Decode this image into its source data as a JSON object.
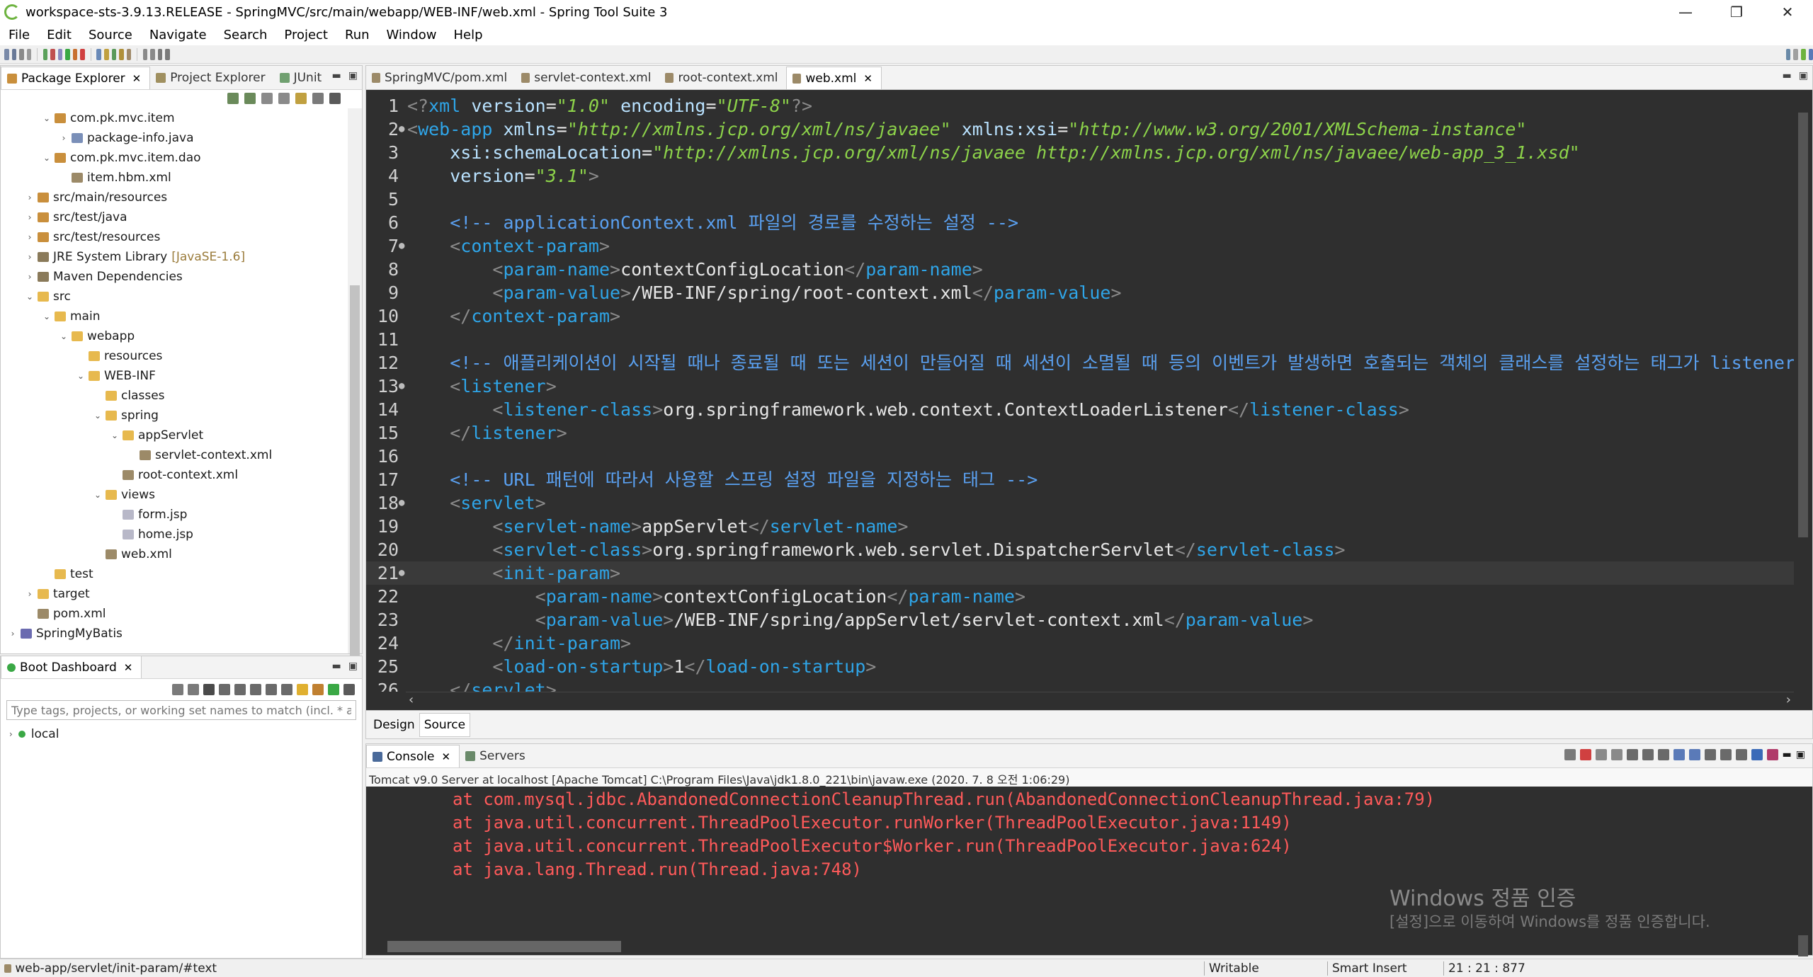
{
  "window": {
    "title": "workspace-sts-3.9.13.RELEASE - SpringMVC/src/main/webapp/WEB-INF/web.xml - Spring Tool Suite 3",
    "controls": [
      "—",
      "❐",
      "✕"
    ]
  },
  "menu": [
    "File",
    "Edit",
    "Source",
    "Navigate",
    "Search",
    "Project",
    "Run",
    "Window",
    "Help"
  ],
  "left_panel": {
    "tabs": [
      {
        "label": "Package Explorer",
        "active": true,
        "closable": true
      },
      {
        "label": "Project Explorer",
        "active": false
      },
      {
        "label": "JUnit",
        "active": false
      }
    ],
    "tree": [
      {
        "label": "com.pk.mvc.item",
        "depth": 2,
        "expanded": true,
        "icon": "package-icon"
      },
      {
        "label": "package-info.java",
        "depth": 3,
        "expanded": false,
        "icon": "java-file-icon",
        "twisty": "›"
      },
      {
        "label": "com.pk.mvc.item.dao",
        "depth": 2,
        "expanded": true,
        "icon": "package-icon"
      },
      {
        "label": "item.hbm.xml",
        "depth": 3,
        "icon": "xml-file-icon"
      },
      {
        "label": "src/main/resources",
        "depth": 1,
        "expanded": false,
        "icon": "source-folder-icon"
      },
      {
        "label": "src/test/java",
        "depth": 1,
        "expanded": false,
        "icon": "source-folder-icon"
      },
      {
        "label": "src/test/resources",
        "depth": 1,
        "expanded": false,
        "icon": "source-folder-icon"
      },
      {
        "label": "JRE System Library",
        "decoration": "[JavaSE-1.6]",
        "depth": 1,
        "expanded": false,
        "icon": "library-icon"
      },
      {
        "label": "Maven Dependencies",
        "depth": 1,
        "expanded": false,
        "icon": "library-icon"
      },
      {
        "label": "src",
        "depth": 1,
        "expanded": true,
        "icon": "folder-icon"
      },
      {
        "label": "main",
        "depth": 2,
        "expanded": true,
        "icon": "folder-icon"
      },
      {
        "label": "webapp",
        "depth": 3,
        "expanded": true,
        "icon": "folder-icon"
      },
      {
        "label": "resources",
        "depth": 4,
        "icon": "folder-icon"
      },
      {
        "label": "WEB-INF",
        "depth": 4,
        "expanded": true,
        "icon": "folder-icon"
      },
      {
        "label": "classes",
        "depth": 5,
        "icon": "folder-icon"
      },
      {
        "label": "spring",
        "depth": 5,
        "expanded": true,
        "icon": "folder-icon"
      },
      {
        "label": "appServlet",
        "depth": 6,
        "expanded": true,
        "icon": "folder-icon"
      },
      {
        "label": "servlet-context.xml",
        "depth": 7,
        "icon": "xml-file-icon"
      },
      {
        "label": "root-context.xml",
        "depth": 6,
        "icon": "xml-file-icon"
      },
      {
        "label": "views",
        "depth": 5,
        "expanded": true,
        "icon": "folder-icon"
      },
      {
        "label": "form.jsp",
        "depth": 6,
        "icon": "jsp-file-icon"
      },
      {
        "label": "home.jsp",
        "depth": 6,
        "icon": "jsp-file-icon"
      },
      {
        "label": "web.xml",
        "depth": 5,
        "icon": "xml-file-icon"
      },
      {
        "label": "test",
        "depth": 2,
        "icon": "folder-icon"
      },
      {
        "label": "target",
        "depth": 1,
        "expanded": false,
        "icon": "folder-icon"
      },
      {
        "label": "pom.xml",
        "depth": 1,
        "icon": "xml-file-icon"
      },
      {
        "label": "SpringMyBatis",
        "depth": 0,
        "expanded": false,
        "icon": "project-icon"
      }
    ]
  },
  "boot_dashboard": {
    "tab_label": "Boot Dashboard",
    "filter_placeholder": "Type tags, projects, or working set names to match (incl. * a",
    "local_label": "local"
  },
  "editor": {
    "tabs": [
      {
        "label": "SpringMVC/pom.xml",
        "active": false
      },
      {
        "label": "servlet-context.xml",
        "active": false
      },
      {
        "label": "root-context.xml",
        "active": false
      },
      {
        "label": "web.xml",
        "active": true
      }
    ],
    "current_line": 21,
    "lines": [
      {
        "n": "1",
        "fold": "",
        "tokens": [
          [
            "p",
            "<?"
          ],
          [
            "t",
            "xml"
          ],
          [
            "x",
            " "
          ],
          [
            "a",
            "version"
          ],
          [
            "x",
            "="
          ],
          [
            "s",
            "\"1.0\""
          ],
          [
            "x",
            " "
          ],
          [
            "a",
            "encoding"
          ],
          [
            "x",
            "="
          ],
          [
            "s",
            "\"UTF-8\""
          ],
          [
            "p",
            "?>"
          ]
        ]
      },
      {
        "n": "2",
        "fold": "●",
        "tokens": [
          [
            "p",
            "<"
          ],
          [
            "t",
            "web-app"
          ],
          [
            "x",
            " "
          ],
          [
            "a",
            "xmlns"
          ],
          [
            "x",
            "="
          ],
          [
            "s",
            "\"http://xmlns.jcp.org/xml/ns/javaee\""
          ],
          [
            "x",
            " "
          ],
          [
            "a",
            "xmlns:xsi"
          ],
          [
            "x",
            "="
          ],
          [
            "s",
            "\"http://www.w3.org/2001/XMLSchema-instance\""
          ]
        ]
      },
      {
        "n": "3",
        "fold": "",
        "tokens": [
          [
            "x",
            "    "
          ],
          [
            "a",
            "xsi:schemaLocation"
          ],
          [
            "x",
            "="
          ],
          [
            "s",
            "\"http://xmlns.jcp.org/xml/ns/javaee http://xmlns.jcp.org/xml/ns/javaee/web-app_3_1.xsd\""
          ]
        ]
      },
      {
        "n": "4",
        "fold": "",
        "tokens": [
          [
            "x",
            "    "
          ],
          [
            "a",
            "version"
          ],
          [
            "x",
            "="
          ],
          [
            "s",
            "\"3.1\""
          ],
          [
            "p",
            ">"
          ]
        ]
      },
      {
        "n": "5",
        "fold": "",
        "tokens": []
      },
      {
        "n": "6",
        "fold": "",
        "tokens": [
          [
            "x",
            "    "
          ],
          [
            "c",
            "<!-- applicationContext.xml 파일의 경로를 수정하는 설정 -->"
          ]
        ]
      },
      {
        "n": "7",
        "fold": "●",
        "tokens": [
          [
            "x",
            "    "
          ],
          [
            "p",
            "<"
          ],
          [
            "t",
            "context-param"
          ],
          [
            "p",
            ">"
          ]
        ]
      },
      {
        "n": "8",
        "fold": "",
        "tokens": [
          [
            "x",
            "        "
          ],
          [
            "p",
            "<"
          ],
          [
            "t",
            "param-name"
          ],
          [
            "p",
            ">"
          ],
          [
            "q",
            "contextConfigLocation"
          ],
          [
            "p",
            "</"
          ],
          [
            "t",
            "param-name"
          ],
          [
            "p",
            ">"
          ]
        ]
      },
      {
        "n": "9",
        "fold": "",
        "tokens": [
          [
            "x",
            "        "
          ],
          [
            "p",
            "<"
          ],
          [
            "t",
            "param-value"
          ],
          [
            "p",
            ">"
          ],
          [
            "q",
            "/WEB-INF/spring/root-context.xml"
          ],
          [
            "p",
            "</"
          ],
          [
            "t",
            "param-value"
          ],
          [
            "p",
            ">"
          ]
        ]
      },
      {
        "n": "10",
        "fold": "",
        "tokens": [
          [
            "x",
            "    "
          ],
          [
            "p",
            "</"
          ],
          [
            "t",
            "context-param"
          ],
          [
            "p",
            ">"
          ]
        ]
      },
      {
        "n": "11",
        "fold": "",
        "tokens": []
      },
      {
        "n": "12",
        "fold": "",
        "tokens": [
          [
            "x",
            "    "
          ],
          [
            "c",
            "<!-- 애플리케이션이 시작될 때나 종료될 때 또는 세션이 만들어질 때 세션이 소멸될 때 등의 이벤트가 발생하면 호출되는 객체의 클래스를 설정하는 태그가 listener -->"
          ]
        ]
      },
      {
        "n": "13",
        "fold": "●",
        "tokens": [
          [
            "x",
            "    "
          ],
          [
            "p",
            "<"
          ],
          [
            "t",
            "listener"
          ],
          [
            "p",
            ">"
          ]
        ]
      },
      {
        "n": "14",
        "fold": "",
        "tokens": [
          [
            "x",
            "        "
          ],
          [
            "p",
            "<"
          ],
          [
            "t",
            "listener-class"
          ],
          [
            "p",
            ">"
          ],
          [
            "q",
            "org.springframework.web.context.ContextLoaderListener"
          ],
          [
            "p",
            "</"
          ],
          [
            "t",
            "listener-class"
          ],
          [
            "p",
            ">"
          ]
        ]
      },
      {
        "n": "15",
        "fold": "",
        "tokens": [
          [
            "x",
            "    "
          ],
          [
            "p",
            "</"
          ],
          [
            "t",
            "listener"
          ],
          [
            "p",
            ">"
          ]
        ]
      },
      {
        "n": "16",
        "fold": "",
        "tokens": []
      },
      {
        "n": "17",
        "fold": "",
        "tokens": [
          [
            "x",
            "    "
          ],
          [
            "c",
            "<!-- URL 패턴에 따라서 사용할 스프링 설정 파일을 지정하는 태그 -->"
          ]
        ]
      },
      {
        "n": "18",
        "fold": "●",
        "tokens": [
          [
            "x",
            "    "
          ],
          [
            "p",
            "<"
          ],
          [
            "t",
            "servlet"
          ],
          [
            "p",
            ">"
          ]
        ]
      },
      {
        "n": "19",
        "fold": "",
        "tokens": [
          [
            "x",
            "        "
          ],
          [
            "p",
            "<"
          ],
          [
            "t",
            "servlet-name"
          ],
          [
            "p",
            ">"
          ],
          [
            "q",
            "appServlet"
          ],
          [
            "p",
            "</"
          ],
          [
            "t",
            "servlet-name"
          ],
          [
            "p",
            ">"
          ]
        ]
      },
      {
        "n": "20",
        "fold": "",
        "tokens": [
          [
            "x",
            "        "
          ],
          [
            "p",
            "<"
          ],
          [
            "t",
            "servlet-class"
          ],
          [
            "p",
            ">"
          ],
          [
            "q",
            "org.springframework.web.servlet.DispatcherServlet"
          ],
          [
            "p",
            "</"
          ],
          [
            "t",
            "servlet-class"
          ],
          [
            "p",
            ">"
          ]
        ]
      },
      {
        "n": "21",
        "fold": "●",
        "tokens": [
          [
            "x",
            "        "
          ],
          [
            "p",
            "<"
          ],
          [
            "t",
            "init-param"
          ],
          [
            "p",
            ">"
          ]
        ]
      },
      {
        "n": "22",
        "fold": "",
        "tokens": [
          [
            "x",
            "            "
          ],
          [
            "p",
            "<"
          ],
          [
            "t",
            "param-name"
          ],
          [
            "p",
            ">"
          ],
          [
            "q",
            "contextConfigLocation"
          ],
          [
            "p",
            "</"
          ],
          [
            "t",
            "param-name"
          ],
          [
            "p",
            ">"
          ]
        ]
      },
      {
        "n": "23",
        "fold": "",
        "tokens": [
          [
            "x",
            "            "
          ],
          [
            "p",
            "<"
          ],
          [
            "t",
            "param-value"
          ],
          [
            "p",
            ">"
          ],
          [
            "q",
            "/WEB-INF/spring/appServlet/servlet-context.xml"
          ],
          [
            "p",
            "</"
          ],
          [
            "t",
            "param-value"
          ],
          [
            "p",
            ">"
          ]
        ]
      },
      {
        "n": "24",
        "fold": "",
        "tokens": [
          [
            "x",
            "        "
          ],
          [
            "p",
            "</"
          ],
          [
            "t",
            "init-param"
          ],
          [
            "p",
            ">"
          ]
        ]
      },
      {
        "n": "25",
        "fold": "",
        "tokens": [
          [
            "x",
            "        "
          ],
          [
            "p",
            "<"
          ],
          [
            "t",
            "load-on-startup"
          ],
          [
            "p",
            ">"
          ],
          [
            "q",
            "1"
          ],
          [
            "p",
            "</"
          ],
          [
            "t",
            "load-on-startup"
          ],
          [
            "p",
            ">"
          ]
        ]
      },
      {
        "n": "26",
        "fold": "",
        "tokens": [
          [
            "x",
            "    "
          ],
          [
            "p",
            "</"
          ],
          [
            "t",
            "servlet"
          ],
          [
            "p",
            ">"
          ]
        ]
      }
    ],
    "bottom_tabs": [
      "Design",
      "Source"
    ],
    "active_bottom_tab": "Source"
  },
  "console": {
    "tabs": [
      {
        "label": "Console",
        "active": true,
        "closable": true
      },
      {
        "label": "Servers",
        "active": false
      }
    ],
    "header": "Tomcat v9.0 Server at localhost [Apache Tomcat] C:\\Program Files\\Java\\jdk1.8.0_221\\bin\\javaw.exe  (2020. 7. 8 오전 1:06:29)",
    "lines": [
      "\tat com.mysql.jdbc.AbandonedConnectionCleanupThread.run(AbandonedConnectionCleanupThread.java:79)",
      "\tat java.util.concurrent.ThreadPoolExecutor.runWorker(ThreadPoolExecutor.java:1149)",
      "\tat java.util.concurrent.ThreadPoolExecutor$Worker.run(ThreadPoolExecutor.java:624)",
      "\tat java.lang.Thread.run(Thread.java:748)"
    ],
    "error_color": "#ff5a5a"
  },
  "watermark": {
    "line1": "Windows 정품 인증",
    "line2": "[설정]으로 이동하여 Windows를 정품 인증합니다."
  },
  "statusbar": {
    "path": "web-app/servlet/init-param/#text",
    "writable": "Writable",
    "insert_mode": "Smart Insert",
    "position": "21 : 21 : 877"
  },
  "colors": {
    "editor_bg": "#2f2f2f",
    "tag": "#2fa5e8",
    "attribute": "#b9e2ff",
    "string": "#8dd34a",
    "comment": "#5aa0f0"
  }
}
